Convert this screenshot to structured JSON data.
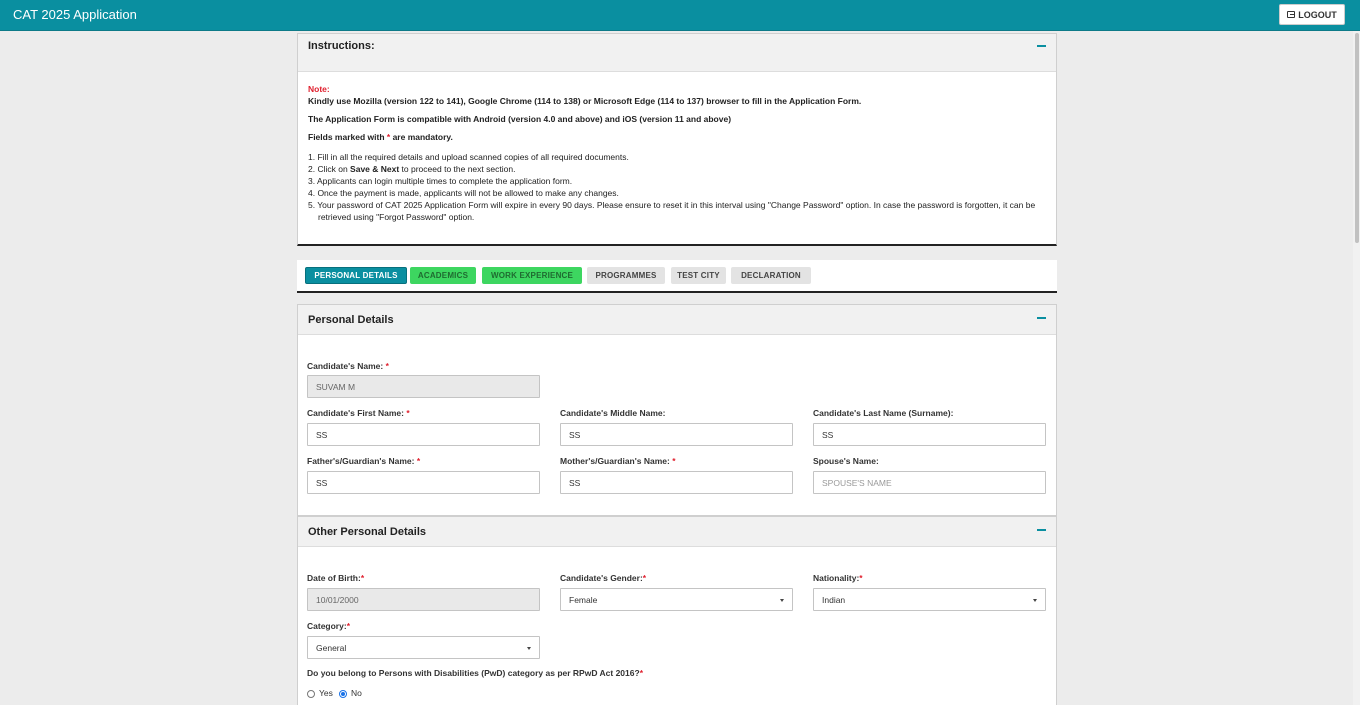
{
  "header": {
    "title": "CAT 2025 Application",
    "logout_label": "LOGOUT"
  },
  "instructions": {
    "title": "Instructions:",
    "note_label": "Note:",
    "line1": "Kindly use Mozilla (version 122 to 141), Google Chrome (114 to 138) or Microsoft Edge (114 to 137) browser to fill in the Application Form.",
    "line2": "The Application Form is compatible with Android (version 4.0 and above) and iOS (version 11 and above)",
    "line3_pre": "Fields marked with ",
    "line3_star": "*",
    "line3_post": " are mandatory.",
    "steps": [
      "1. Fill in all the required details and upload scanned copies of all required documents.",
      "2. Click on ",
      "3. Applicants can login multiple times to complete the application form.",
      "4. Once the payment is made, applicants will not be allowed to make any changes.",
      "5. Your password of CAT 2025 Application Form will expire in every 90 days. Please ensure to reset it in this interval using \"Change Password\" option. In case the password is forgotten, it can be retrieved using \"Forgot Password\" option."
    ],
    "step2_bold": "Save & Next",
    "step2_post": " to proceed to the next section."
  },
  "tabs": [
    {
      "label": "PERSONAL DETAILS",
      "state": "active"
    },
    {
      "label": "ACADEMICS",
      "state": "done"
    },
    {
      "label": "WORK EXPERIENCE",
      "state": "done"
    },
    {
      "label": "PROGRAMMES",
      "state": "todo"
    },
    {
      "label": "TEST CITY",
      "state": "todo"
    },
    {
      "label": "DECLARATION",
      "state": "todo"
    }
  ],
  "personal": {
    "title": "Personal Details",
    "name_label": "Candidate's Name:",
    "name_value": "SUVAM M",
    "first_label": "Candidate's First Name:",
    "first_value": "SS",
    "middle_label": "Candidate's Middle Name:",
    "middle_value": "SS",
    "last_label": "Candidate's Last Name (Surname):",
    "last_value": "SS",
    "father_label": "Father's/Guardian's Name:",
    "father_value": "SS",
    "mother_label": "Mother's/Guardian's Name:",
    "mother_value": "SS",
    "spouse_label": "Spouse's Name:",
    "spouse_placeholder": "SPOUSE'S NAME"
  },
  "other": {
    "title": "Other Personal Details",
    "dob_label": "Date of Birth:",
    "dob_value": "10/01/2000",
    "gender_label": "Candidate's Gender:",
    "gender_value": "Female",
    "nationality_label": "Nationality:",
    "nationality_value": "Indian",
    "category_label": "Category:",
    "category_value": "General",
    "pwd_label": "Do you belong to Persons with Disabilities (PwD) category as per RPwD Act 2016?",
    "pwd_yes": "Yes",
    "pwd_no": "No",
    "pwd_selected": "No"
  },
  "required_mark": "*",
  "colors": {
    "header": "#0a8fa0",
    "active_tab": "#0a8fa0",
    "done_tab": "#3dd660",
    "required": "#e0202e"
  }
}
